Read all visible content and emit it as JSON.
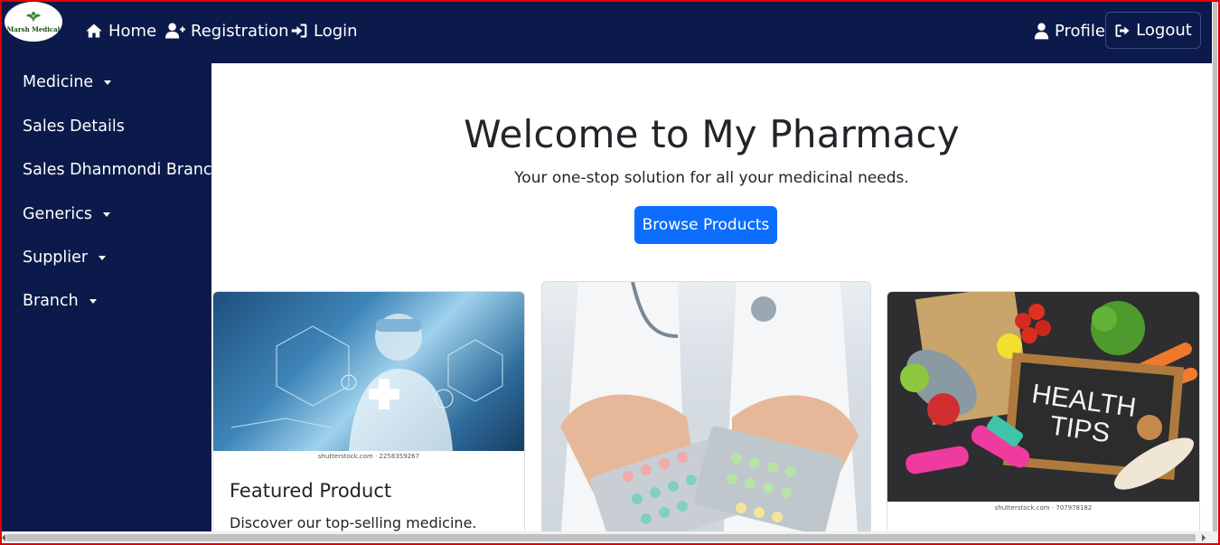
{
  "navbar": {
    "logo_text": "Marsh Medical",
    "home_label": "Home",
    "registration_label": "Registration",
    "login_label": "Login",
    "profile_label": "Profile",
    "logout_label": "Logout",
    "background_color": "#0b1a4a"
  },
  "sidebar": {
    "items": [
      {
        "label": "Medicine",
        "dropdown": true
      },
      {
        "label": "Sales Details",
        "dropdown": false
      },
      {
        "label": "Sales Dhanmondi Branch",
        "dropdown": false
      },
      {
        "label": "Generics",
        "dropdown": true
      },
      {
        "label": "Supplier",
        "dropdown": true
      },
      {
        "label": "Branch",
        "dropdown": true
      }
    ]
  },
  "hero": {
    "title": "Welcome to My Pharmacy",
    "subtitle": "Your one-stop solution for all your medicinal needs.",
    "button_label": "Browse Products",
    "button_color": "#0d6efd"
  },
  "cards": [
    {
      "image": "doctor-digital-health-image",
      "image_caption": "shutterstock.com · 2258359267",
      "title": "Featured Product",
      "text": "Discover our top-selling medicine."
    },
    {
      "image": "hands-holding-pill-blisters-image"
    },
    {
      "image": "health-tips-food-image",
      "image_caption": "shutterstock.com · 707978182",
      "board_text": "HEALTH TIPS"
    }
  ]
}
